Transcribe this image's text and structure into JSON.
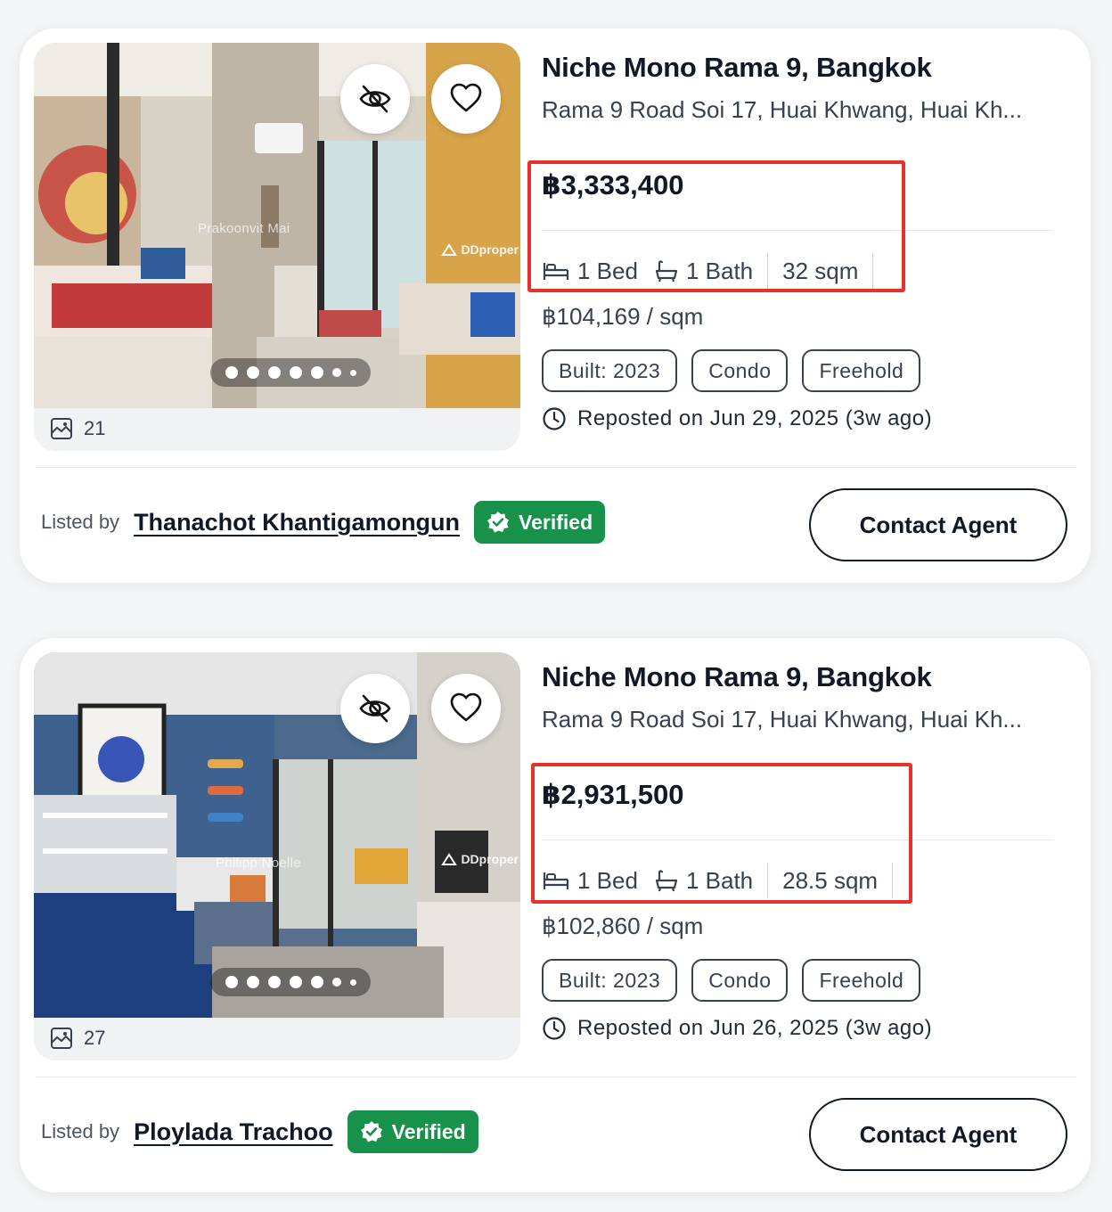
{
  "accent": {
    "highlight": "#e8302d",
    "verified": "#18914b"
  },
  "listings": [
    {
      "title": "Niche Mono Rama 9, Bangkok",
      "address": "Rama 9 Road Soi 17, Huai Khwang, Huai Kh...",
      "price": "฿3,333,400",
      "beds": "1 Bed",
      "baths": "1 Bath",
      "area": "32 sqm",
      "price_per_sqm": "฿104,169 / sqm",
      "tags": [
        "Built: 2023",
        "Condo",
        "Freehold"
      ],
      "reposted": "Reposted on Jun 29, 2025 (3w ago)",
      "photo_count": "21",
      "photo_watermark": "Prakoonvit Mai",
      "photo_brand": "DDproper",
      "listed_by_label": "Listed by",
      "agent_name": "Thanachot Khantigamongun",
      "verified_label": "Verified",
      "contact_label": "Contact Agent",
      "icons": [
        "hide-icon",
        "heart-icon",
        "gallery-icon",
        "bed-icon",
        "bath-icon",
        "clock-icon",
        "verified-check-icon"
      ]
    },
    {
      "title": "Niche Mono Rama 9, Bangkok",
      "address": "Rama 9 Road Soi 17, Huai Khwang, Huai Kh...",
      "price": "฿2,931,500",
      "beds": "1 Bed",
      "baths": "1 Bath",
      "area": "28.5 sqm",
      "price_per_sqm": "฿102,860 / sqm",
      "tags": [
        "Built: 2023",
        "Condo",
        "Freehold"
      ],
      "reposted": "Reposted on Jun 26, 2025 (3w ago)",
      "photo_count": "27",
      "photo_watermark": "Philipp Noelle",
      "photo_brand": "DDproper",
      "listed_by_label": "Listed by",
      "agent_name": "Ploylada Trachoo",
      "verified_label": "Verified",
      "contact_label": "Contact Agent",
      "icons": [
        "hide-icon",
        "heart-icon",
        "gallery-icon",
        "bed-icon",
        "bath-icon",
        "clock-icon",
        "verified-check-icon"
      ]
    }
  ]
}
